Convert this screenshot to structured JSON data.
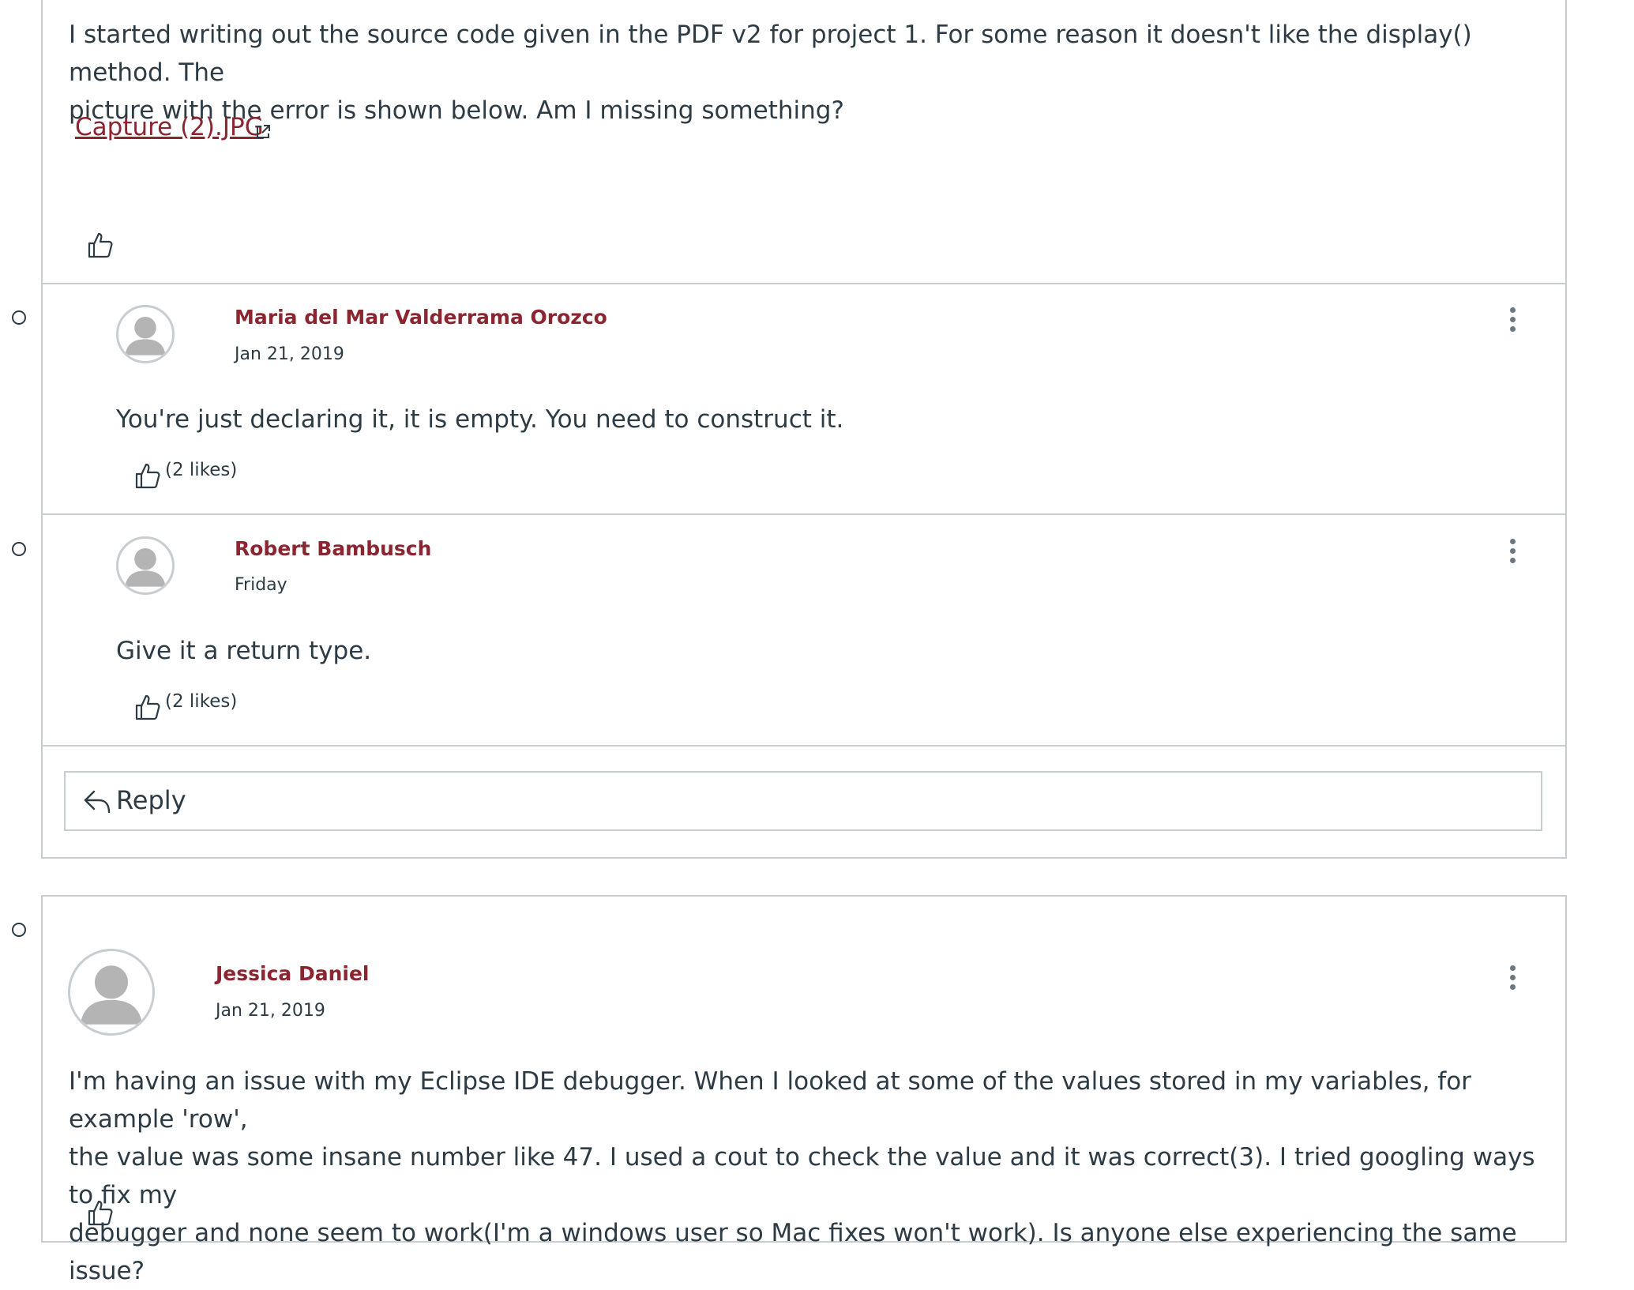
{
  "first_post": {
    "body": "I started writing out the source code given in the PDF v2 for project 1. For some reason it doesn't like the display() method. The\npicture with the error is shown below. Am I missing something?",
    "attachment_label": "Capture (2).JPG",
    "attachment_icon": "external-link-icon"
  },
  "replies": [
    {
      "author": "Maria del Mar Valderrama Orozco",
      "date": "Jan 21, 2019",
      "body": "You're just declaring it, it is empty. You need to construct it.",
      "likes": "(2 likes)"
    },
    {
      "author": "Robert Bambusch",
      "date": "Friday",
      "body": "Give it a return type.",
      "likes": "(2 likes)"
    }
  ],
  "reply_button": {
    "label": "Reply"
  },
  "second_post": {
    "author": "Jessica Daniel",
    "date": "Jan 21, 2019",
    "body": "I'm having an issue with my Eclipse IDE debugger. When I looked at some of the values stored in my variables, for example 'row',\nthe value was some insane number like 47. I used a cout to check the value and it was correct(3). I tried googling ways to fix my\ndebugger and none seem to work(I'm a windows user so Mac fixes won't work). Is anyone else experiencing the same issue?"
  },
  "colors": {
    "author_link": "#8b2530",
    "text": "#2d3b45",
    "border": "#c7cdd1",
    "avatar_gray": "#b4b4b4"
  }
}
